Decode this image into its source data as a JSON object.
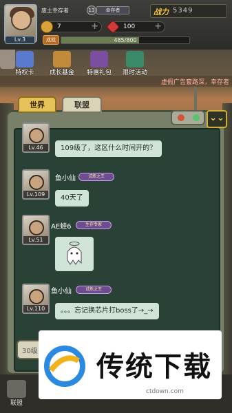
{
  "player": {
    "name": "废土幸存者",
    "level": "Lv.3",
    "rank_badge": "13",
    "rank_title": "幸存者",
    "power_label": "战力",
    "power_value": "5349",
    "vip": "成就",
    "exp_text": "485/800",
    "exp_fraction": 0.606
  },
  "resources": [
    {
      "icon": "gold-coin-icon",
      "value": "7"
    },
    {
      "icon": "red-gem-icon",
      "value": "100"
    }
  ],
  "menu": [
    {
      "label": "特权卡",
      "icon": "privilege-card-icon"
    },
    {
      "label": "成长基金",
      "icon": "growth-fund-icon"
    },
    {
      "label": "特惠礼包",
      "icon": "gift-pack-icon"
    },
    {
      "label": "限时活动",
      "icon": "limited-event-icon"
    }
  ],
  "promo": "虚假广告套路深，幸存者",
  "tabs": {
    "world": "世界",
    "alliance": "联盟"
  },
  "messages": [
    {
      "level": "Lv.46",
      "text": "109级了，这区什么时间开的？"
    },
    {
      "name": "鱼小仙",
      "badge": "试炼之王",
      "level": "Lv.109",
      "text": "40天了"
    },
    {
      "name": "AE蛙6",
      "badge": "生存专家",
      "level": "Lv.51",
      "sticker": "ghost-sticker-icon"
    },
    {
      "name": "鱼小仙",
      "badge": "试炼之王",
      "level": "Lv.110",
      "text": "。。。忘记换芯片打boss了→_→"
    }
  ],
  "input": {
    "placeholder": "30级"
  },
  "bottom_nav": [
    {
      "label": "",
      "icon": "battle-icon"
    },
    {
      "label": "联盟",
      "icon": "alliance-icon"
    }
  ],
  "watermark": {
    "title": "传统下载",
    "url": "ctdown.com"
  },
  "colors": {
    "accent": "#e6c35a",
    "screen": "#2a4236",
    "bubble": "#cfe4d6",
    "power": "#f5c542"
  }
}
